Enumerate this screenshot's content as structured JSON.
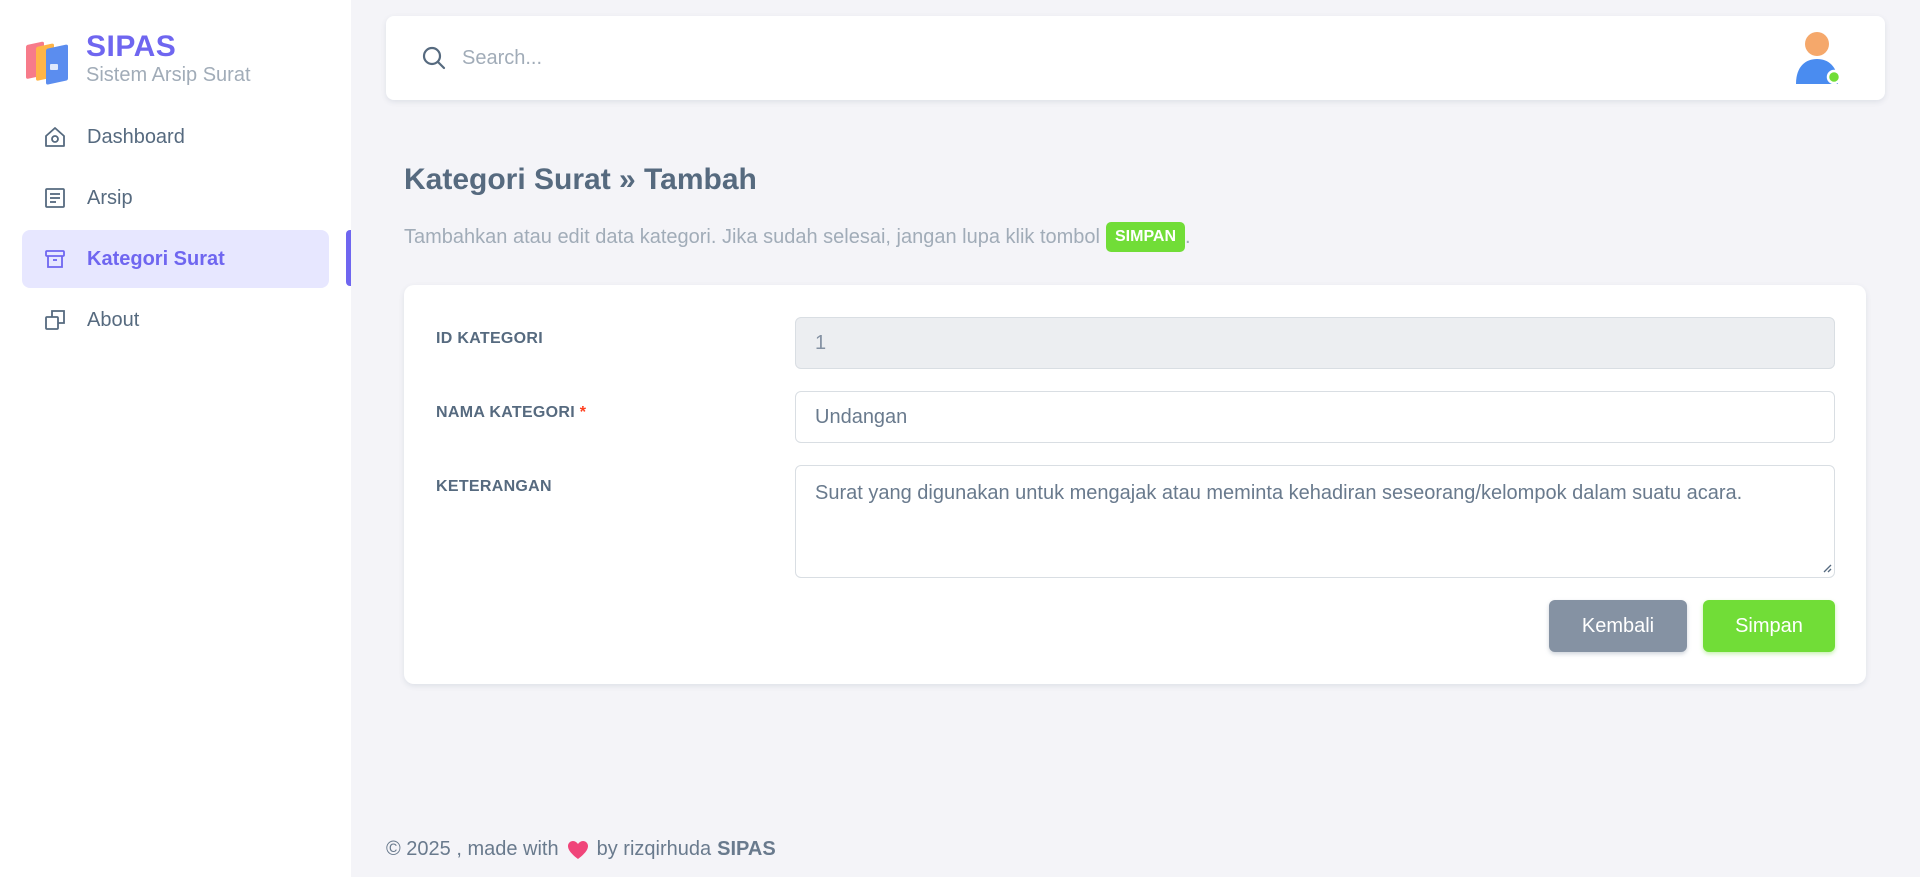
{
  "brand": {
    "name": "SIPAS",
    "subtitle": "Sistem Arsip Surat"
  },
  "sidebar": {
    "items": [
      {
        "label": "Dashboard",
        "icon": "home-icon"
      },
      {
        "label": "Arsip",
        "icon": "document-icon"
      },
      {
        "label": "Kategori Surat",
        "icon": "archive-icon",
        "active": true
      },
      {
        "label": "About",
        "icon": "copy-icon"
      }
    ]
  },
  "navbar": {
    "search_placeholder": "Search..."
  },
  "page": {
    "title": "Kategori Surat » Tambah",
    "description": "Tambahkan atau edit data kategori. Jika sudah selesai, jangan lupa klik tombol",
    "description_badge": "SIMPAN",
    "description_end": "."
  },
  "form": {
    "id_label": "ID KATEGORI",
    "id_value": "1",
    "name_label": "NAMA KATEGORI",
    "name_required_mark": "*",
    "name_value": "Undangan",
    "desc_label": "KETERANGAN",
    "desc_value": "Surat yang digunakan untuk mengajak atau meminta kehadiran seseorang/kelompok dalam suatu acara.",
    "back_label": "Kembali",
    "save_label": "Simpan"
  },
  "footer": {
    "prefix": "© 2025 , made with",
    "by": "by rizqirhuda",
    "brand": "SIPAS"
  },
  "colors": {
    "primary": "#6f66f0",
    "success": "#71dd37",
    "secondary": "#8592a3",
    "text": "#566a7f",
    "muted": "#a1acb8",
    "background": "#f4f4f8"
  }
}
